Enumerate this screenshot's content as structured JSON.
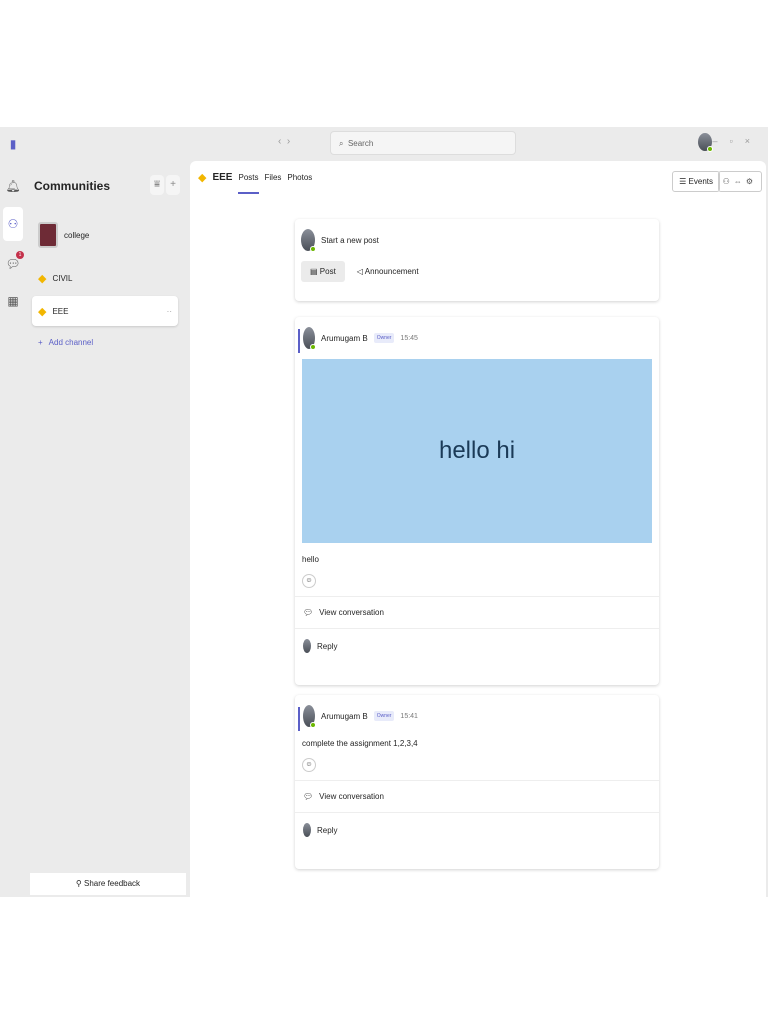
{
  "titlebar": {
    "search_placeholder": "Search"
  },
  "sidebar": {
    "title": "Communities",
    "items": [
      {
        "label": "college"
      },
      {
        "label": "CIVIL"
      },
      {
        "label": "EEE"
      }
    ],
    "add_channel": "Add channel",
    "feedback": "Share feedback",
    "badge": "1"
  },
  "channel": {
    "name": "EEE",
    "tabs": [
      "Posts",
      "Files",
      "Photos"
    ],
    "events": "Events"
  },
  "compose": {
    "placeholder": "Start a new post",
    "post": "Post",
    "announcement": "Announcement"
  },
  "posts": [
    {
      "author": "Arumugam B",
      "role": "Owner",
      "time": "15:45",
      "image_text": "hello hi",
      "body": "hello",
      "view": "View conversation",
      "reply": "Reply"
    },
    {
      "author": "Arumugam B",
      "role": "Owner",
      "time": "15:41",
      "body": "complete the assignment 1,2,3,4",
      "view": "View conversation",
      "reply": "Reply"
    }
  ],
  "colors": {
    "accent": "#5b5fc7",
    "image_bg": "#a9d1ef",
    "image_text": "#1b3a57"
  }
}
